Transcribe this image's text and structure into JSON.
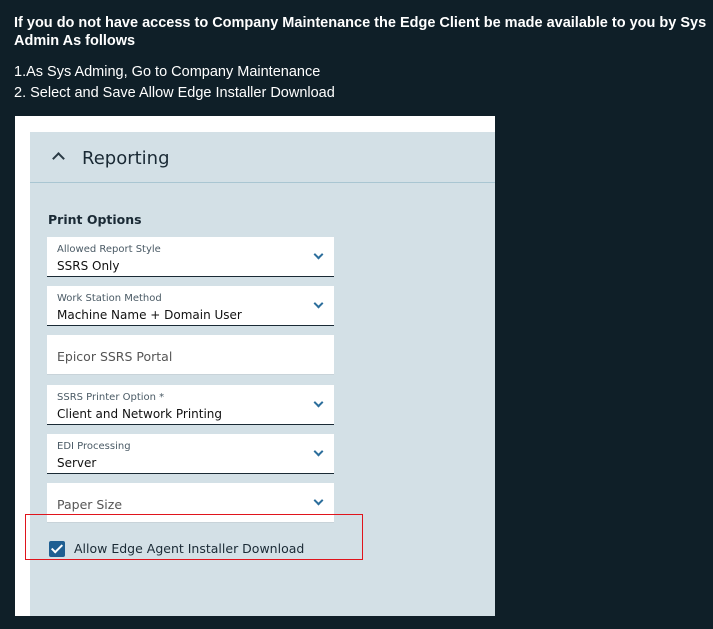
{
  "intro": {
    "title": "If you do not have access to Company Maintenance the Edge Client be made available to you by Sys Admin As follows",
    "steps": [
      "1.As Sys Adming, Go to Company Maintenance",
      "2. Select and Save Allow Edge Installer Download"
    ]
  },
  "screenshot": {
    "panel_title": "Reporting",
    "section_label": "Print Options",
    "fields": [
      {
        "label": "Allowed Report Style",
        "value": "SSRS Only"
      },
      {
        "label": "Work Station Method",
        "value": "Machine Name + Domain User"
      },
      {
        "placeholder": "Epicor SSRS Portal"
      },
      {
        "label": "SSRS Printer Option *",
        "value": "Client and Network Printing"
      },
      {
        "label": "EDI Processing",
        "value": "Server"
      },
      {
        "placeholder": "Paper Size"
      }
    ],
    "checkbox": {
      "label": "Allow Edge Agent Installer Download",
      "checked": true
    }
  },
  "colors": {
    "background": "#0f1f28",
    "panel": "#d3e0e6",
    "accent": "#1f5f92",
    "highlight": "#e0141c"
  }
}
